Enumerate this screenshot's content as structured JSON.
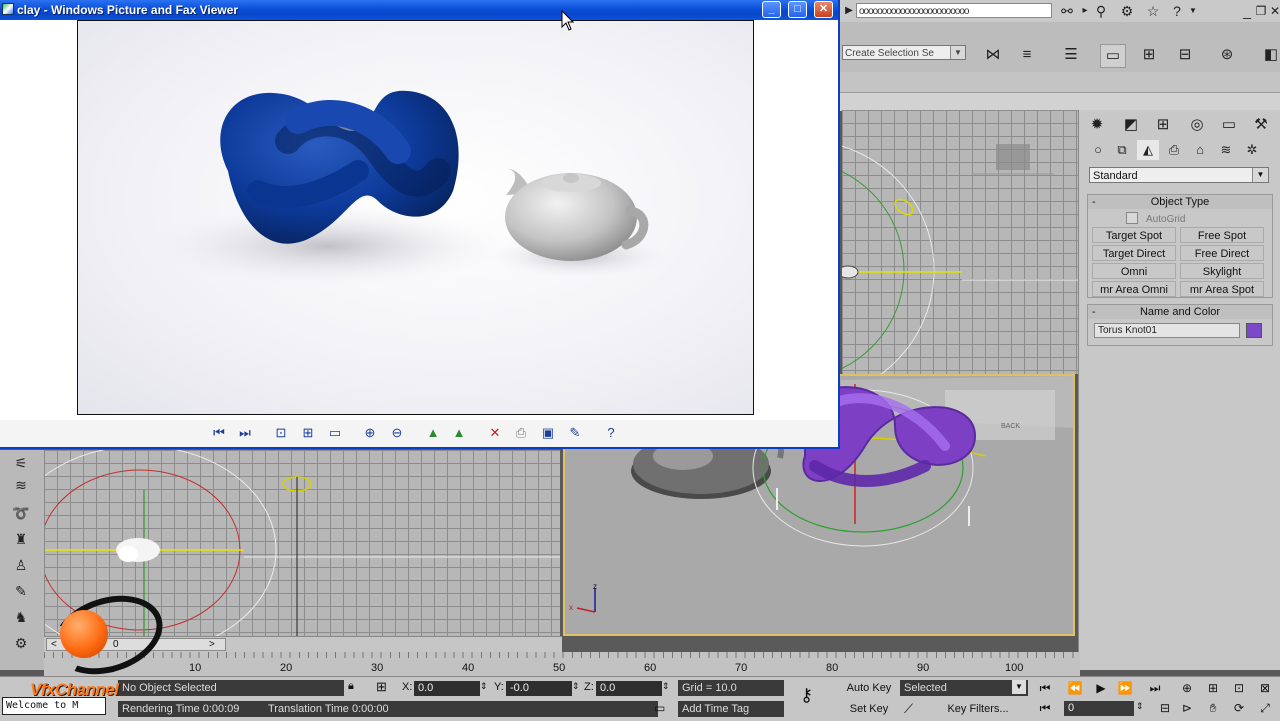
{
  "viewer": {
    "title": "clay - Windows Picture and Fax Viewer",
    "controls": {
      "minimize": "_",
      "maximize": "□",
      "close": "✕"
    },
    "toolbar_icons": [
      "previous-image-icon",
      "next-image-icon",
      "best-fit-icon",
      "actual-size-icon",
      "slideshow-icon",
      "zoom-in-icon",
      "zoom-out-icon",
      "rotate-clockwise-icon",
      "rotate-counterclockwise-icon",
      "delete-icon",
      "print-icon",
      "save-icon",
      "edit-icon",
      "help-icon"
    ]
  },
  "max_topbar": {
    "search_text": "oooooooooooooooooooooooo"
  },
  "max_toolbar": {
    "named_selection": "Create Selection Se"
  },
  "command_panel": {
    "category": "Standard",
    "object_type": {
      "title": "Object Type",
      "autogrid": "AutoGrid",
      "buttons": [
        "Target Spot",
        "Free Spot",
        "Target Direct",
        "Free Direct",
        "Omni",
        "Skylight",
        "mr Area Omni",
        "mr Area Spot"
      ]
    },
    "name_color": {
      "title": "Name and Color",
      "name": "Torus Knot01",
      "color": "#7b48c8"
    }
  },
  "viewport_labels": {
    "persp_axis_x": "x",
    "persp_axis_z": "z",
    "back_label": "BACK"
  },
  "time_slider": {
    "lt": "<",
    "value": "0",
    "gt": ">"
  },
  "track_ticks": [
    "10",
    "20",
    "30",
    "40",
    "50",
    "60",
    "70",
    "80",
    "90",
    "100"
  ],
  "status": {
    "selection": "No Object Selected",
    "x_label": "X:",
    "x_value": "0.0",
    "y_label": "Y:",
    "y_value": "-0.0",
    "z_label": "Z:",
    "z_value": "0.0",
    "grid": "Grid = 10.0",
    "rendering_time": "Rendering Time  0:00:09",
    "translation_time": "Translation Time  0:00:00",
    "add_time_tag": "Add Time Tag",
    "auto_key": "Auto Key",
    "key_mode": "Selected",
    "set_key": "Set Key",
    "key_filters": "Key Filters...",
    "frame": "0"
  },
  "watermark": {
    "brand": "VfxChannel",
    "welcome": "Welcome to M"
  }
}
